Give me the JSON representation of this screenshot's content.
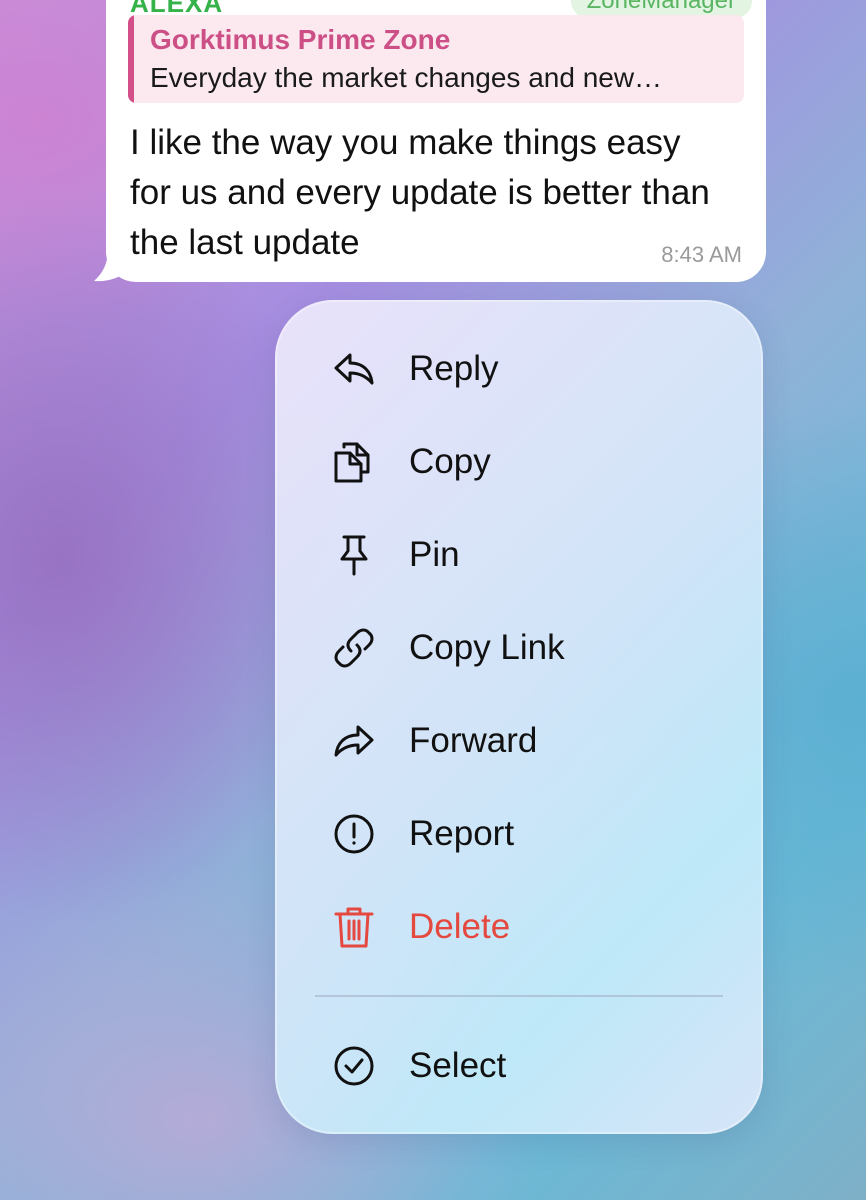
{
  "message": {
    "sender": "ALEXA",
    "badge": "ZoneManager",
    "quote_title": "Gorktimus Prime Zone",
    "quote_text": "Everyday the market changes and new…",
    "text": "I like the way you make things easy for us and every update is better than the last update",
    "time": "8:43 AM"
  },
  "menu": {
    "items": [
      {
        "label": "Reply",
        "icon": "reply-icon"
      },
      {
        "label": "Copy",
        "icon": "copy-icon"
      },
      {
        "label": "Pin",
        "icon": "pin-icon"
      },
      {
        "label": "Copy Link",
        "icon": "link-icon"
      },
      {
        "label": "Forward",
        "icon": "forward-icon"
      },
      {
        "label": "Report",
        "icon": "report-icon"
      },
      {
        "label": "Delete",
        "icon": "trash-icon",
        "color": "#e5483f"
      },
      {
        "label": "Select",
        "icon": "check-circle-icon"
      }
    ]
  },
  "colors": {
    "sender": "#35b34a",
    "quote_accent": "#d24f8a",
    "danger": "#e5483f"
  }
}
